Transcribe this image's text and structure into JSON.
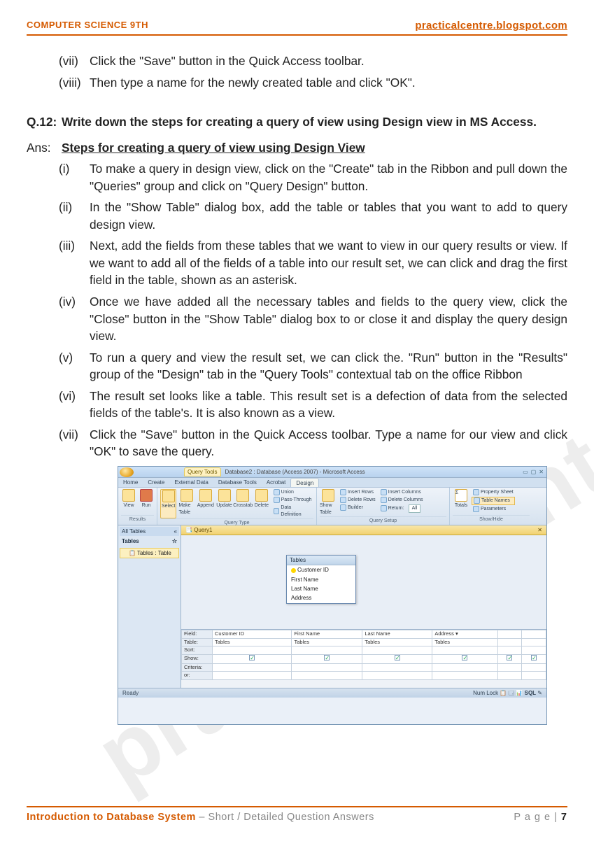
{
  "header": {
    "left": "COMPUTER SCIENCE 9TH",
    "right": "practicalcentre.blogspot.com"
  },
  "watermark": "practicalcentre.blogspot.com",
  "top_steps": [
    {
      "num": "(vii)",
      "text": "Click the \"Save\" button in the Quick Access toolbar."
    },
    {
      "num": "(viii)",
      "text": "Then type a name for the newly created table and click \"OK\"."
    }
  ],
  "question": {
    "label": "Q.12:",
    "text": "Write down the steps for creating a query of view using Design view in MS Access."
  },
  "answer": {
    "label": "Ans:",
    "heading": "Steps for creating a query of view using Design View"
  },
  "steps": [
    {
      "num": "(i)",
      "text": "To make a query in design view, click on the \"Create\" tab in the Ribbon and pull down the \"Queries\" group and click on \"Query Design\" button."
    },
    {
      "num": "(ii)",
      "text": "In the \"Show Table\" dialog box, add the table or tables that you want to add to query design view."
    },
    {
      "num": "(iii)",
      "text": "Next, add the fields from these tables that we want to view in our query results or view. If we want to add all of the fields of a table into our result set, we can click and drag the first field in the table, shown as an asterisk."
    },
    {
      "num": "(iv)",
      "text": "Once we have added all the necessary tables and fields to the query view, click the \"Close\" button in the \"Show Table\" dialog box to or close it and display the query design view."
    },
    {
      "num": "(v)",
      "text": "To run a query and view the result set, we can click the. \"Run\" button in the \"Results\" group of the \"Design\" tab in the \"Query Tools\" contextual tab on the office Ribbon"
    },
    {
      "num": "(vi)",
      "text": "The result set looks like a table. This result set is a defection of data from the selected fields of the table's. It is also known as a view."
    },
    {
      "num": "(vii)",
      "text": "Click the \"Save\" button in the Quick Access toolbar. Type a name for our view and click \"OK\" to save the query."
    }
  ],
  "screenshot": {
    "context_tab": "Query Tools",
    "title": "Database2 : Database (Access 2007) - Microsoft Access",
    "tabs": [
      "Home",
      "Create",
      "External Data",
      "Database Tools",
      "Acrobat",
      "Design"
    ],
    "active_tab": "Design",
    "groups": {
      "results": {
        "label": "Results",
        "buttons": [
          "View",
          "Run"
        ]
      },
      "querytype": {
        "label": "Query Type",
        "big": [
          "Select",
          "Make Table",
          "Append",
          "Update",
          "Crosstab",
          "Delete"
        ],
        "small": [
          "Union",
          "Pass-Through",
          "Data Definition"
        ]
      },
      "setup": {
        "label": "Query Setup",
        "big": "Show Table",
        "rows": [
          "Insert Rows",
          "Delete Rows",
          "Builder"
        ],
        "cols": [
          "Insert Columns",
          "Delete Columns",
          "Return:"
        ],
        "return_val": "All"
      },
      "showhide": {
        "label": "Show/Hide",
        "big": "Totals",
        "items": [
          "Property Sheet",
          "Table Names",
          "Parameters"
        ]
      }
    },
    "nav": {
      "header": "All Tables",
      "category": "Tables",
      "item": "Tables : Table"
    },
    "query_tab": "Query1",
    "table_box": {
      "title": "Tables",
      "fields": [
        "Customer ID",
        "First Name",
        "Last Name",
        "Address"
      ]
    },
    "grid": {
      "rows": [
        "Field:",
        "Table:",
        "Sort:",
        "Show:",
        "Criteria:",
        "or:"
      ],
      "cols": [
        {
          "field": "Customer ID",
          "table": "Tables"
        },
        {
          "field": "First Name",
          "table": "Tables"
        },
        {
          "field": "Last Name",
          "table": "Tables"
        },
        {
          "field": "Address",
          "table": "Tables"
        }
      ]
    },
    "status": {
      "left": "Ready",
      "right": "Num Lock"
    }
  },
  "footer": {
    "chapter": "Introduction to Database System",
    "subtitle": " – Short / Detailed Question Answers",
    "page_label": "P a g e  | ",
    "page_num": "7"
  }
}
